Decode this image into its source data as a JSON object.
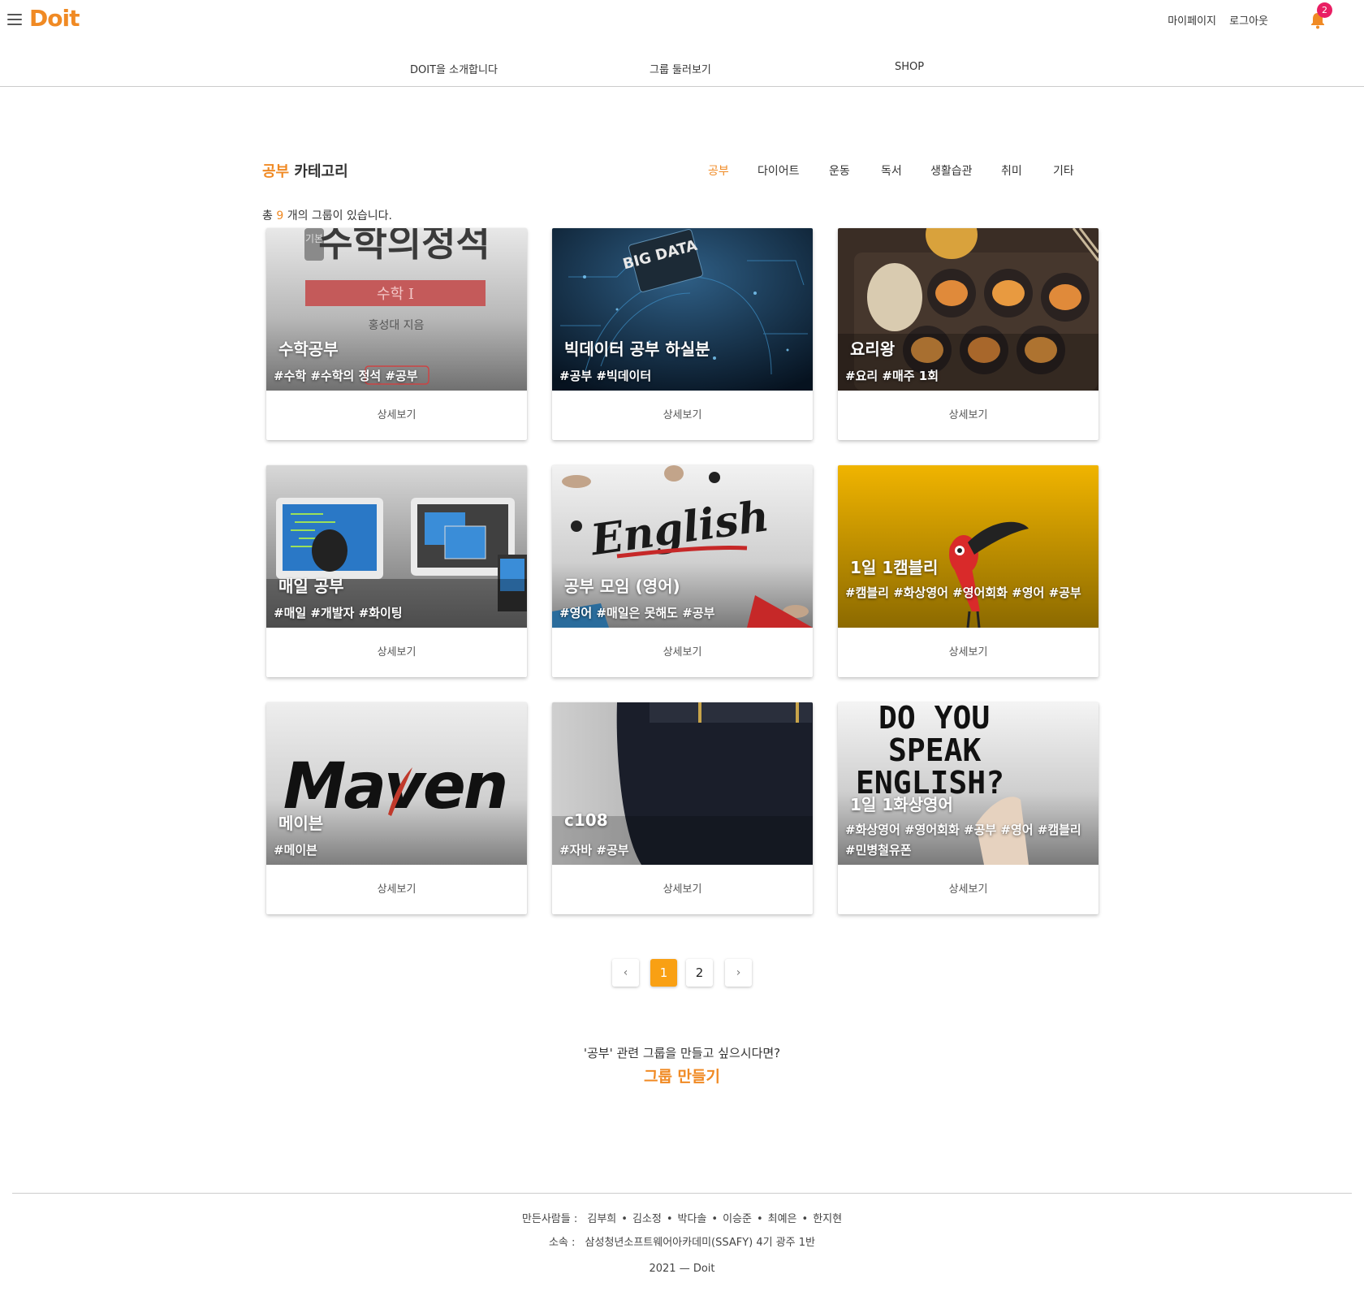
{
  "header": {
    "logo": "Doit",
    "mypage": "마이페이지",
    "logout": "로그아웃",
    "notification_count": "2",
    "accent_color": "#f08a24",
    "badge_color": "#e91e63"
  },
  "nav": {
    "intro": "DOIT을 소개합니다",
    "browse": "그룹 둘러보기",
    "shop": "SHOP"
  },
  "category": {
    "name": "공부",
    "suffix": " 카테고리",
    "tabs": [
      "공부",
      "다이어트",
      "운동",
      "독서",
      "생활습관",
      "취미",
      "기타"
    ],
    "active_tab": "공부"
  },
  "count": {
    "prefix": "총 ",
    "number": "9",
    "suffix": " 개의 그룹이 있습니다."
  },
  "cards": [
    {
      "title": "수학공부",
      "tags": "#수학  #수학의 정석  #공부",
      "button": "상세보기",
      "image": "math-book-cover"
    },
    {
      "title": "빅데이터 공부 하실분",
      "tags": "#공부  #빅데이터",
      "button": "상세보기",
      "image": "big-data-illustration"
    },
    {
      "title": "요리왕",
      "tags": "#요리  #매주 1회",
      "button": "상세보기",
      "image": "food-photo"
    },
    {
      "title": "매일 공부",
      "tags": "#매일  #개발자  #화이팅",
      "button": "상세보기",
      "image": "developer-illustration"
    },
    {
      "title": "공부 모임 (영어)",
      "tags": "#영어  #매일은 못해도  #공부",
      "button": "상세보기",
      "image": "english-whiteboard"
    },
    {
      "title": "1일 1캠블리",
      "tags": "#캠블리  #화상영어  #영어회화  #영어  #공부",
      "button": "상세보기",
      "image": "toucan-illustration"
    },
    {
      "title": "메이븐",
      "tags": "#메이븐",
      "button": "상세보기",
      "image": "maven-logo"
    },
    {
      "title": "c108",
      "tags": "#자바  #공부",
      "button": "상세보기",
      "image": "dark-object-photo"
    },
    {
      "title": "1일 1화상영어",
      "tags": "#화상영어  #영어회화  #공부  #영어  #캠블리  #민병철유폰",
      "button": "상세보기",
      "image": "do-you-speak-english"
    }
  ],
  "pagination": {
    "prev": "‹",
    "pages": [
      "1",
      "2"
    ],
    "current": "1",
    "next": "›"
  },
  "create": {
    "question": "'공부' 관련 그룹을 만들고 싶으시다면?",
    "link": "그룹 만들기"
  },
  "footer": {
    "makers_label": "만든사람들 :",
    "makers": [
      "김부희",
      "김소정",
      "박다솔",
      "이승준",
      "최예은",
      "한지현"
    ],
    "org_label": "소속 :",
    "org": "삼성청년소프트웨어아카데미(SSAFY) 4기 광주 1반",
    "copyright": "2021 — Doit"
  },
  "image_text": {
    "math_book_title": "수학의정석",
    "math_book_vertical": "기본",
    "math_book_band": "수학 I",
    "math_book_author": "홍성대 지음",
    "big_data": "BIG DATA",
    "english_board": "English",
    "maven_logo": "Maven",
    "speak_english": "DO YOU SPEAK ENGLISH?"
  }
}
